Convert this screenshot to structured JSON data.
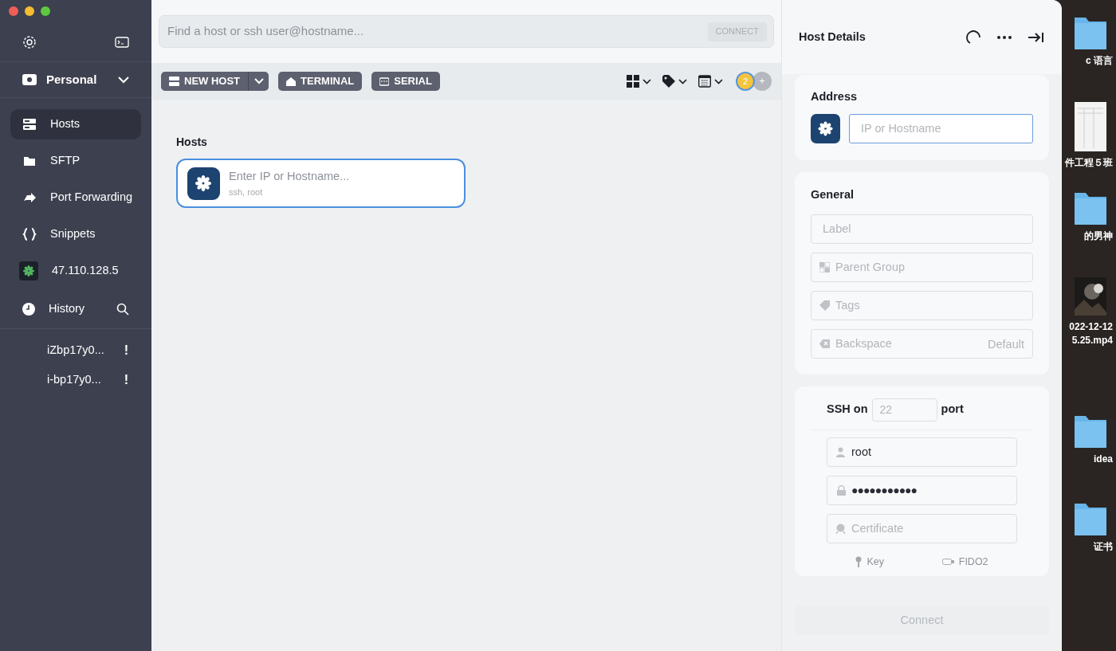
{
  "sidebar": {
    "profile": "Personal",
    "nav": [
      {
        "label": "Hosts",
        "kind": "hosts",
        "selected": true
      },
      {
        "label": "SFTP",
        "kind": "sftp",
        "selected": false
      },
      {
        "label": "Port Forwarding",
        "kind": "port_forwarding",
        "selected": false
      },
      {
        "label": "Snippets",
        "kind": "snippets",
        "selected": false
      },
      {
        "label": "47.110.128.5",
        "kind": "host",
        "selected": false
      }
    ],
    "history_label": "History",
    "history": [
      {
        "label": "iZbp17y0...",
        "status": "!"
      },
      {
        "label": "i-bp17y0...",
        "status": "!"
      }
    ]
  },
  "search": {
    "placeholder": "Find a host or ssh user@hostname...",
    "button": "CONNECT",
    "button_disabled": true
  },
  "toolbar": {
    "new_host": "NEW HOST",
    "buttons": [
      {
        "label": "TERMINAL",
        "kind": "terminal"
      },
      {
        "label": "SERIAL",
        "kind": "serial"
      }
    ],
    "badge": "2",
    "add": "+"
  },
  "hosts": {
    "title": "Hosts",
    "items": [
      {
        "title": "Enter IP or Hostname...",
        "subtitle": "ssh, root",
        "selected": true
      }
    ]
  },
  "details": {
    "title": "Host Details",
    "address": {
      "title": "Address",
      "placeholder": "IP or Hostname"
    },
    "general": {
      "title": "General",
      "fields": [
        {
          "kind": "plain",
          "placeholder": "Label"
        },
        {
          "kind": "group",
          "placeholder": "Parent Group"
        },
        {
          "kind": "tags",
          "placeholder": "Tags"
        },
        {
          "kind": "backspace",
          "placeholder": "Backspace",
          "value": "Default"
        }
      ]
    },
    "ssh": {
      "label_before": "SSH on",
      "port_placeholder": "22",
      "label_after": "port",
      "fields": [
        {
          "kind": "user",
          "value": "root"
        },
        {
          "kind": "password",
          "value": "●●●●●●●●●●●"
        },
        {
          "kind": "certificate",
          "placeholder": "Certificate"
        }
      ],
      "links": [
        {
          "label": "Key",
          "kind": "key"
        },
        {
          "label": "FIDO2",
          "kind": "fido"
        }
      ]
    },
    "connect": {
      "label": "Connect",
      "disabled": true
    }
  },
  "desktop": [
    {
      "kind": "folder",
      "labels": [
        "c 语言"
      ]
    },
    {
      "kind": "document",
      "labels": [
        "件工程５班"
      ]
    },
    {
      "kind": "folder",
      "labels": [
        "的男神"
      ]
    },
    {
      "kind": "video",
      "labels": [
        "022-12-12",
        "5.25.mp4"
      ]
    },
    {
      "kind": "folder",
      "labels": [
        "idea"
      ]
    },
    {
      "kind": "folder",
      "labels": [
        "证书"
      ]
    }
  ]
}
